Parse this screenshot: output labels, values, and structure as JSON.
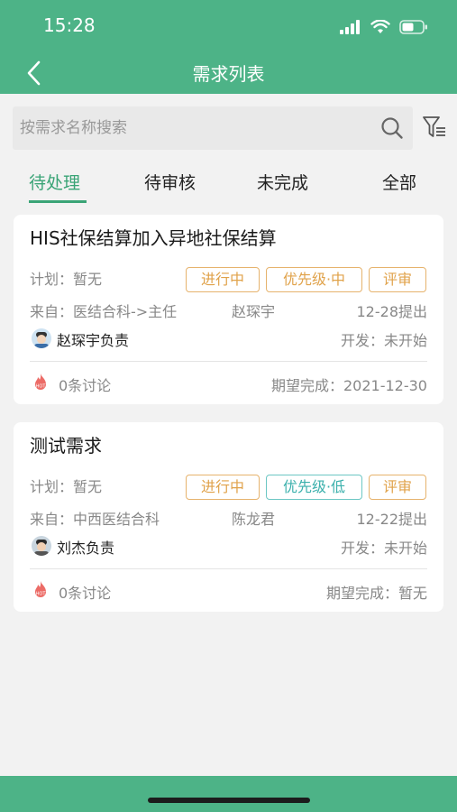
{
  "status_bar": {
    "time": "15:28"
  },
  "nav": {
    "title": "需求列表"
  },
  "search": {
    "placeholder": "按需求名称搜索"
  },
  "tabs": [
    {
      "label": "待处理",
      "active": true
    },
    {
      "label": "待审核",
      "active": false
    },
    {
      "label": "未完成",
      "active": false
    },
    {
      "label": "全部",
      "active": false
    }
  ],
  "cards": [
    {
      "title": "HIS社保结算加入异地社保结算",
      "plan": "计划：暂无",
      "tags": [
        "进行中",
        "优先级·中",
        "评审"
      ],
      "from": "来自：医结合科->主任",
      "person": "赵琛宇",
      "submitted": "12-28提出",
      "owner": "赵琛宇负责",
      "dev_status": "开发：未开始",
      "discussion": "0条讨论",
      "expected": "期望完成：2021-12-30"
    },
    {
      "title": "测试需求",
      "plan": "计划：暂无",
      "tags": [
        "进行中",
        "优先级·低",
        "评审"
      ],
      "from": "来自：中西医结合科",
      "person": "陈龙君",
      "submitted": "12-22提出",
      "owner": "刘杰负责",
      "dev_status": "开发：未开始",
      "discussion": "0条讨论",
      "expected": "期望完成：暂无"
    }
  ],
  "colors": {
    "primary": "#4db387",
    "active_tab": "#3aa476",
    "tag_orange": "#e0a24a",
    "tag_teal": "#3bb0ac",
    "background": "#f2f2f2"
  },
  "icons": {
    "back": "back-arrow-icon",
    "search": "search-icon",
    "filter": "filter-icon",
    "hot": "hot-fire-icon",
    "signal": "signal-icon",
    "wifi": "wifi-icon",
    "battery": "battery-icon"
  }
}
